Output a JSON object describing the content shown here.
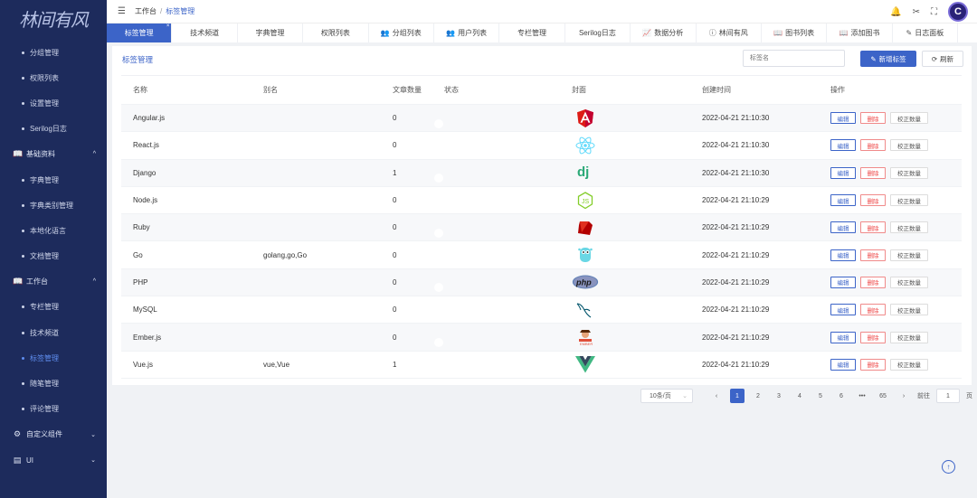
{
  "sidebar": {
    "logo": "林间有风",
    "items": [
      {
        "type": "sub",
        "label": "分组管理"
      },
      {
        "type": "sub",
        "label": "权限列表"
      },
      {
        "type": "sub",
        "label": "设置管理"
      },
      {
        "type": "sub",
        "label": "Serilog日志"
      },
      {
        "type": "group",
        "label": "基础资料",
        "icon": "books-icon",
        "glyph": "📖",
        "chev": "^"
      },
      {
        "type": "sub",
        "label": "字典管理"
      },
      {
        "type": "sub",
        "label": "字典类别管理"
      },
      {
        "type": "sub",
        "label": "本地化语言"
      },
      {
        "type": "sub",
        "label": "文档管理"
      },
      {
        "type": "group",
        "label": "工作台",
        "icon": "books-icon",
        "glyph": "📖",
        "chev": "^"
      },
      {
        "type": "sub",
        "label": "专栏管理"
      },
      {
        "type": "sub",
        "label": "技术频道"
      },
      {
        "type": "sub",
        "label": "标签管理",
        "active": true
      },
      {
        "type": "sub",
        "label": "随笔管理"
      },
      {
        "type": "sub",
        "label": "评论管理"
      },
      {
        "type": "group",
        "label": "自定义组件",
        "icon": "gear-icon",
        "glyph": "⚙",
        "chev": "⌄"
      },
      {
        "type": "group",
        "label": "UI",
        "icon": "layout-icon",
        "glyph": "▤",
        "chev": "⌄"
      }
    ]
  },
  "header": {
    "menu_icon": "☰",
    "breadcrumb": [
      "工作台",
      "标签管理"
    ],
    "separator": "/",
    "icons": {
      "bell": "🔔",
      "tool": "✂",
      "fullscreen": "⛶"
    },
    "avatar_letter": "C"
  },
  "tabs": [
    {
      "label": "标签管理",
      "active": true,
      "close": "×"
    },
    {
      "label": "技术频道"
    },
    {
      "label": "字典管理"
    },
    {
      "label": "权限列表"
    },
    {
      "label": "分组列表",
      "icon": "users-icon",
      "glyph": "👥"
    },
    {
      "label": "用户列表",
      "icon": "users-icon",
      "glyph": "👥"
    },
    {
      "label": "专栏管理"
    },
    {
      "label": "Serilog日志"
    },
    {
      "label": "数据分析",
      "icon": "chart-icon",
      "glyph": "📈"
    },
    {
      "label": "林间有风",
      "icon": "info-icon",
      "glyph": "ⓘ"
    },
    {
      "label": "图书列表",
      "icon": "books-icon",
      "glyph": "📖"
    },
    {
      "label": "添加图书",
      "icon": "books-icon",
      "glyph": "📖"
    },
    {
      "label": "日志面板",
      "icon": "edit-icon",
      "glyph": "✎"
    }
  ],
  "panel": {
    "title": "标签管理",
    "search_placeholder": "标签名",
    "add_button": "新增标签",
    "add_icon": "✎",
    "refresh_button": "刷新",
    "refresh_icon": "⟳"
  },
  "table": {
    "headers": [
      "名称",
      "别名",
      "文章数量",
      "状态",
      "封面",
      "创建时间",
      "操作"
    ],
    "rows": [
      {
        "name": "Angular.js",
        "alias": "",
        "count": "0",
        "status": true,
        "cover": "angular-logo",
        "created": "2022-04-21 21:10:30"
      },
      {
        "name": "React.js",
        "alias": "",
        "count": "0",
        "status": true,
        "cover": "react-logo",
        "created": "2022-04-21 21:10:30"
      },
      {
        "name": "Django",
        "alias": "",
        "count": "1",
        "status": true,
        "cover": "django-logo",
        "created": "2022-04-21 21:10:30"
      },
      {
        "name": "Node.js",
        "alias": "",
        "count": "0",
        "status": true,
        "cover": "nodejs-logo",
        "created": "2022-04-21 21:10:29"
      },
      {
        "name": "Ruby",
        "alias": "",
        "count": "0",
        "status": true,
        "cover": "ruby-logo",
        "created": "2022-04-21 21:10:29"
      },
      {
        "name": "Go",
        "alias": "golang,go,Go",
        "count": "0",
        "status": true,
        "cover": "go-logo",
        "created": "2022-04-21 21:10:29"
      },
      {
        "name": "PHP",
        "alias": "",
        "count": "0",
        "status": true,
        "cover": "php-logo",
        "created": "2022-04-21 21:10:29"
      },
      {
        "name": "MySQL",
        "alias": "",
        "count": "0",
        "status": true,
        "cover": "mysql-logo",
        "created": "2022-04-21 21:10:29"
      },
      {
        "name": "Ember.js",
        "alias": "",
        "count": "0",
        "status": true,
        "cover": "ember-logo",
        "created": "2022-04-21 21:10:29"
      },
      {
        "name": "Vue.js",
        "alias": "vue,Vue",
        "count": "1",
        "status": true,
        "cover": "vue-logo",
        "created": "2022-04-21 21:10:29"
      }
    ],
    "actions": {
      "edit": "编辑",
      "delete": "删除",
      "fix": "校正数量"
    }
  },
  "pagination": {
    "page_size": "10条/页",
    "page_size_chev": "⌄",
    "prev": "‹",
    "next": "›",
    "pages": [
      "1",
      "2",
      "3",
      "4",
      "5",
      "6",
      "•••",
      "65"
    ],
    "current": "1",
    "goto_label": "前往",
    "goto_value": "1",
    "goto_suffix": "页"
  },
  "back_to_top": "↑",
  "colors": {
    "sidebar": "#1d2b5c",
    "primary": "#3c64c8",
    "switch_on": "#3ec17a",
    "danger": "#ee4444"
  }
}
